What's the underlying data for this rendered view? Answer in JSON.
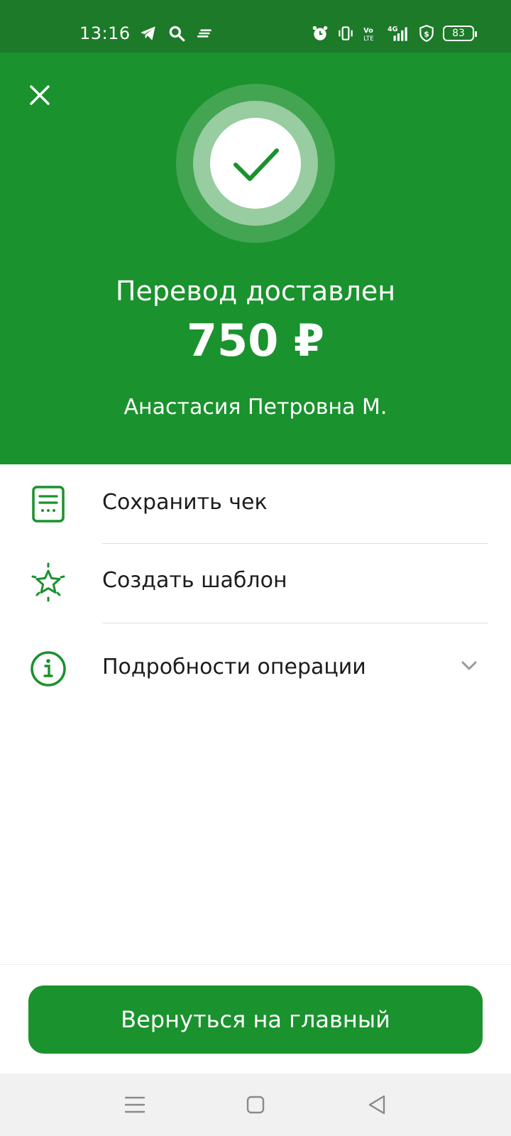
{
  "status_bar": {
    "time": "13:16",
    "battery": "83",
    "left_icons": [
      "telegram-icon",
      "search-icon",
      "notes-icon"
    ],
    "right_icons": [
      "alarm-icon",
      "vibrate-icon",
      "volte-icon",
      "signal-4g-icon",
      "shield-dollar-icon",
      "battery-icon"
    ]
  },
  "hero": {
    "title": "Перевод доставлен",
    "amount": "750 ₽",
    "recipient": "Анастасия Петровна М."
  },
  "actions": [
    {
      "label": "Сохранить чек",
      "icon": "receipt-icon"
    },
    {
      "label": "Создать шаблон",
      "icon": "star-sparkle-icon"
    },
    {
      "label": "Подробности операции",
      "icon": "info-icon",
      "expand_icon": "chevron-down-icon"
    }
  ],
  "footer": {
    "primary_button": "Вернуться на главный"
  },
  "nav": [
    "menu-icon",
    "home-icon",
    "back-icon"
  ],
  "colors": {
    "status_bar": "#1c7a29",
    "brand_green": "#1a922d",
    "text_dark": "#1c1c1c",
    "divider": "#dedede",
    "nav_bg": "#f1f1f1"
  }
}
